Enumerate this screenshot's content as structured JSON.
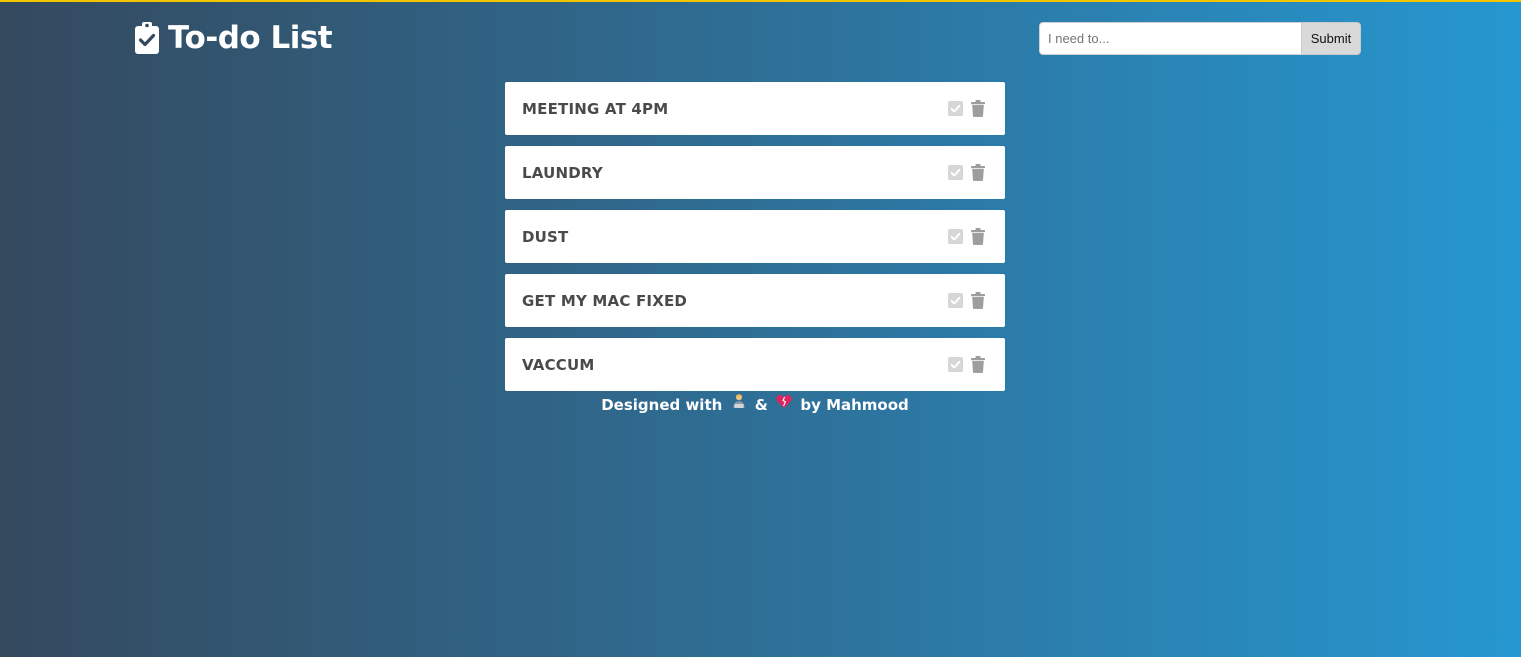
{
  "header": {
    "title": "To-do List",
    "brand_icon": "clipboard-check-icon"
  },
  "add_form": {
    "placeholder": "I need to...",
    "submit_label": "Submit"
  },
  "todos": [
    {
      "text": "Meeting at 4pm"
    },
    {
      "text": "Laundry"
    },
    {
      "text": "Dust"
    },
    {
      "text": "Get my Mac fixed"
    },
    {
      "text": "Vaccum"
    }
  ],
  "footer": {
    "prefix": "Designed with",
    "amp": "&",
    "suffix": "by Mahmood",
    "icons": [
      "technologist-emoji",
      "heart-emoji"
    ]
  },
  "colors": {
    "accent_line": "#f2c500",
    "gradient_start": "#34495e",
    "gradient_end": "#2697d0",
    "item_text": "#4a4a4a",
    "icon_gray": "#9e9e9e"
  }
}
